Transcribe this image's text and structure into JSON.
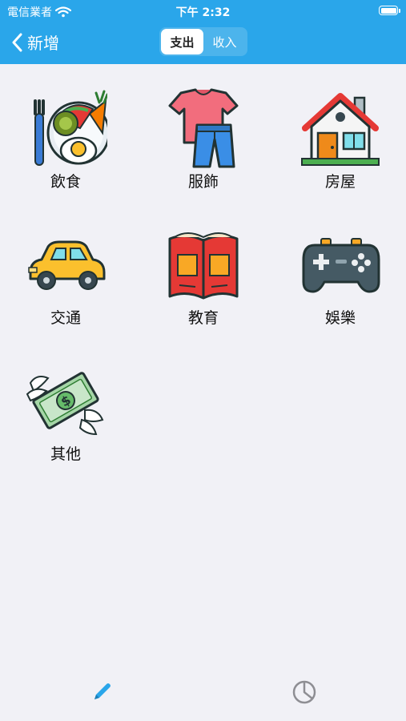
{
  "status_bar": {
    "carrier": "電信業者",
    "time": "下午 2:32"
  },
  "nav": {
    "back_label": "新增",
    "segments": [
      {
        "label": "支出",
        "selected": true
      },
      {
        "label": "收入",
        "selected": false
      }
    ]
  },
  "categories": [
    {
      "label": "飲食",
      "icon": "food-plate-icon"
    },
    {
      "label": "服飾",
      "icon": "clothing-icon"
    },
    {
      "label": "房屋",
      "icon": "house-icon"
    },
    {
      "label": "交通",
      "icon": "car-icon"
    },
    {
      "label": "教育",
      "icon": "book-icon"
    },
    {
      "label": "娛樂",
      "icon": "gamepad-icon"
    },
    {
      "label": "其他",
      "icon": "flying-money-icon"
    }
  ],
  "tab_bar": [
    {
      "name": "add",
      "icon": "pencil-icon",
      "active": true
    },
    {
      "name": "stats",
      "icon": "pie-chart-icon",
      "active": false
    }
  ],
  "colors": {
    "accent": "#2aa6ea",
    "background": "#f1f1f6"
  }
}
